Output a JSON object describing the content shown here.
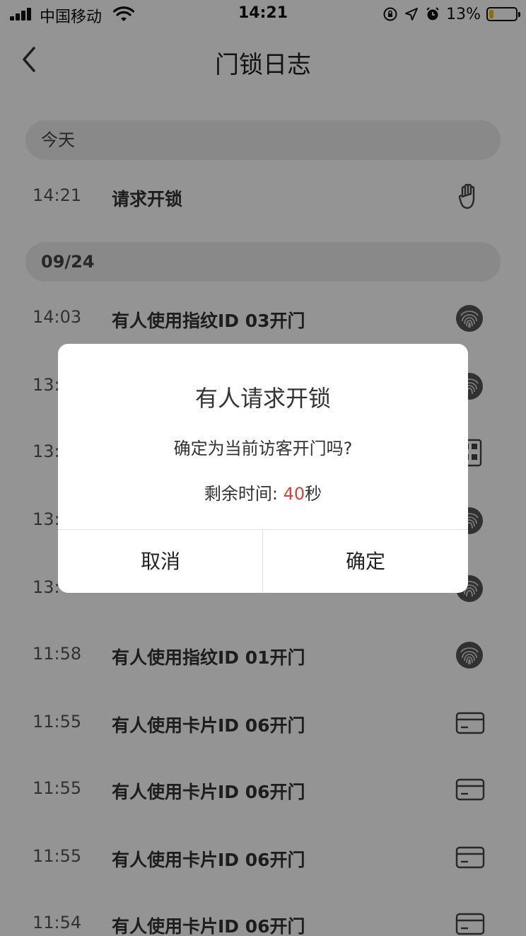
{
  "status_bar": {
    "carrier": "中国移动",
    "time": "14:21",
    "battery_percent": "13%",
    "battery_level": 0.13,
    "icons": [
      "signal-icon",
      "wifi-icon",
      "orientation-lock-icon",
      "location-icon",
      "alarm-icon",
      "battery-icon"
    ]
  },
  "header": {
    "title": "门锁日志",
    "back_icon": "chevron-left-icon"
  },
  "sections": [
    {
      "date": "今天",
      "entries": [
        {
          "time": "14:21",
          "text": "请求开锁",
          "icon": "hand-icon"
        }
      ]
    },
    {
      "date": "09/24",
      "entries": [
        {
          "time": "14:03",
          "text": "有人使用指纹ID 03开门",
          "icon": "fingerprint-icon"
        },
        {
          "time": "13:",
          "text": "",
          "icon": "fingerprint-icon"
        },
        {
          "time": "13:",
          "text": "",
          "icon": "keypad-icon"
        },
        {
          "time": "13:",
          "text": "",
          "icon": "fingerprint-icon"
        },
        {
          "time": "13:",
          "text": "",
          "icon": "fingerprint-icon"
        },
        {
          "time": "11:58",
          "text": "有人使用指纹ID 01开门",
          "icon": "fingerprint-icon"
        },
        {
          "time": "11:55",
          "text": "有人使用卡片ID 06开门",
          "icon": "card-icon"
        },
        {
          "time": "11:55",
          "text": "有人使用卡片ID 06开门",
          "icon": "card-icon"
        },
        {
          "time": "11:55",
          "text": "有人使用卡片ID 06开门",
          "icon": "card-icon"
        },
        {
          "time": "11:54",
          "text": "有人使用卡片ID 06开门",
          "icon": "card-icon"
        }
      ]
    }
  ],
  "dialog": {
    "title": "有人请求开锁",
    "message": "确定为当前访客开门吗?",
    "remaining_label": "剩余时间: ",
    "remaining_seconds": "40",
    "remaining_unit": "秒",
    "cancel_label": "取消",
    "confirm_label": "确定"
  },
  "colors": {
    "accent_red": "#e0403a",
    "date_header_bg": "#ececec",
    "overlay": "rgba(0,0,0,0.42)"
  }
}
